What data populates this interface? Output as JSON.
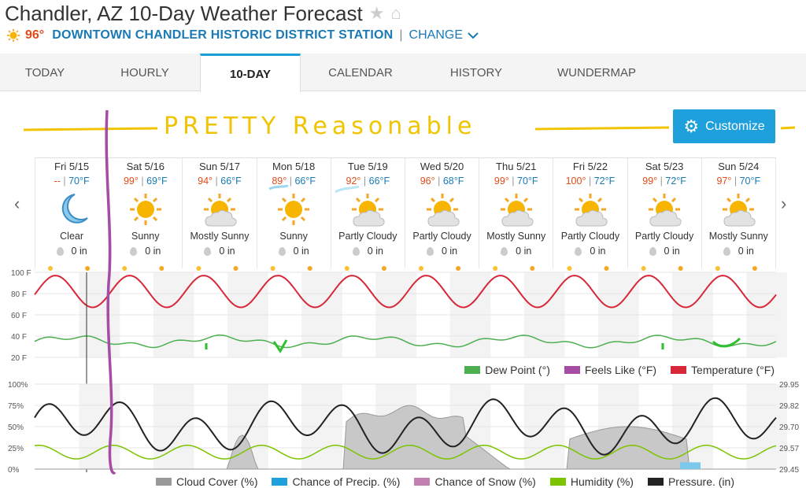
{
  "header": {
    "title": "Chandler, AZ 10-Day Weather Forecast",
    "current_temp": "96°",
    "station": "DOWNTOWN CHANDLER HISTORIC DISTRICT STATION",
    "separator": "|",
    "change_label": "CHANGE"
  },
  "tabs": [
    {
      "label": "TODAY",
      "active": false
    },
    {
      "label": "HOURLY",
      "active": false
    },
    {
      "label": "10-DAY",
      "active": true
    },
    {
      "label": "CALENDAR",
      "active": false
    },
    {
      "label": "HISTORY",
      "active": false
    },
    {
      "label": "WUNDERMAP",
      "active": false
    }
  ],
  "customize_label": "Customize",
  "annotation": {
    "text": "PRETTY  Reasonable"
  },
  "days": [
    {
      "name": "Fri 5/15",
      "hi": "--",
      "lo": "70°F",
      "icon": "moon-icon",
      "condition": "Clear",
      "precip": "0 in"
    },
    {
      "name": "Sat 5/16",
      "hi": "99°",
      "lo": "69°F",
      "icon": "sun-icon",
      "condition": "Sunny",
      "precip": "0 in"
    },
    {
      "name": "Sun 5/17",
      "hi": "94°",
      "lo": "66°F",
      "icon": "partly-cloudy-icon",
      "condition": "Mostly Sunny",
      "precip": "0 in"
    },
    {
      "name": "Mon 5/18",
      "hi": "89°",
      "lo": "66°F",
      "icon": "sun-icon",
      "condition": "Sunny",
      "precip": "0 in"
    },
    {
      "name": "Tue 5/19",
      "hi": "92°",
      "lo": "66°F",
      "icon": "partly-cloudy-icon",
      "condition": "Partly Cloudy",
      "precip": "0 in"
    },
    {
      "name": "Wed 5/20",
      "hi": "96°",
      "lo": "68°F",
      "icon": "partly-cloudy-icon",
      "condition": "Partly Cloudy",
      "precip": "0 in"
    },
    {
      "name": "Thu 5/21",
      "hi": "99°",
      "lo": "70°F",
      "icon": "partly-cloudy-icon",
      "condition": "Mostly Sunny",
      "precip": "0 in"
    },
    {
      "name": "Fri 5/22",
      "hi": "100°",
      "lo": "72°F",
      "icon": "partly-cloudy-icon",
      "condition": "Partly Cloudy",
      "precip": "0 in"
    },
    {
      "name": "Sat 5/23",
      "hi": "99°",
      "lo": "72°F",
      "icon": "partly-cloudy-icon",
      "condition": "Partly Cloudy",
      "precip": "0 in"
    },
    {
      "name": "Sun 5/24",
      "hi": "97°",
      "lo": "70°F",
      "icon": "partly-cloudy-icon",
      "condition": "Mostly Sunny",
      "precip": "0 in"
    }
  ],
  "temp_chart": {
    "y_ticks": [
      "100 F",
      "80 F",
      "60 F",
      "40 F",
      "20 F"
    ],
    "legend": [
      {
        "label": "Dew Point (°)",
        "color": "#4caf50"
      },
      {
        "label": "Feels Like (°F)",
        "color": "#a64ca6"
      },
      {
        "label": "Temperature (°F)",
        "color": "#d62839"
      }
    ]
  },
  "precip_chart": {
    "y_ticks_left": [
      "100%",
      "75%",
      "50%",
      "25%",
      "0%"
    ],
    "y_ticks_right": [
      "29.95",
      "29.82",
      "29.70",
      "29.57",
      "29.45"
    ],
    "legend": [
      {
        "label": "Cloud Cover (%)",
        "color": "#999999"
      },
      {
        "label": "Chance of Precip. (%)",
        "color": "#1ea0dc"
      },
      {
        "label": "Chance of Snow (%)",
        "color": "#c27fb0"
      },
      {
        "label": "Humidity (%)",
        "color": "#7cc300"
      },
      {
        "label": "Pressure. (in)",
        "color": "#222222"
      }
    ]
  },
  "colors": {
    "accent": "#1ea0dc",
    "high": "#e04b1a",
    "low": "#1a7ab5",
    "annotation": "#f0c400"
  }
}
